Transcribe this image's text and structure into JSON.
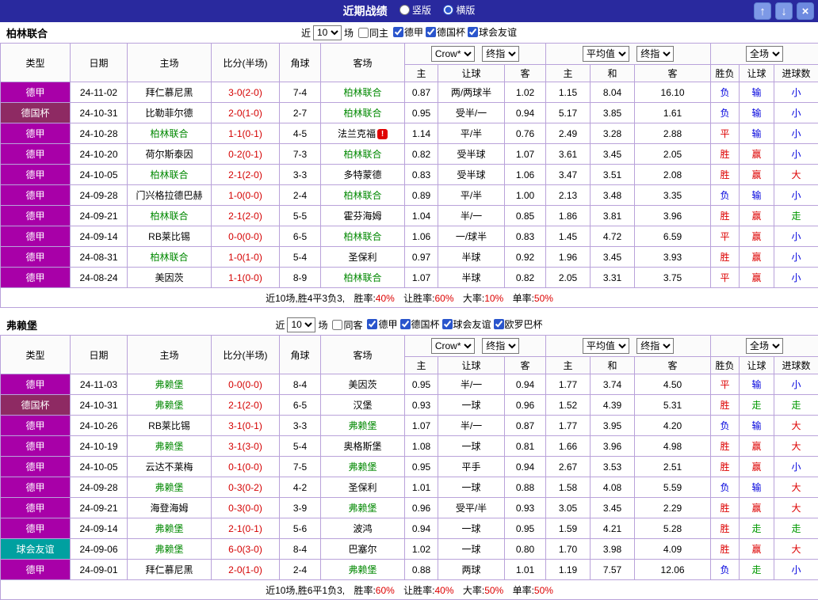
{
  "titlebar": {
    "title": "近期战绩",
    "layout_options": [
      {
        "label": "竖版",
        "selected": false
      },
      {
        "label": "横版",
        "selected": true
      }
    ],
    "buttons": [
      {
        "name": "scroll-up",
        "glyph": "↑"
      },
      {
        "name": "scroll-down",
        "glyph": "↓"
      },
      {
        "name": "close",
        "glyph": "×"
      }
    ]
  },
  "colors": {
    "titlebar_bg": "#29299e",
    "grid_border": "#b9a2da",
    "league": {
      "德甲": "#a800a8",
      "德国杯": "#8e2a63",
      "球会友谊": "#00a0a0"
    },
    "result": {
      "胜": "#dd0000",
      "平": "#dd0000",
      "负": "#0000dd",
      "赢": "#dd0000",
      "输": "#0000dd",
      "走": "#009900",
      "大": "#dd0000",
      "小": "#0000dd"
    },
    "score_text": "#d40000",
    "focus_team": "#008800",
    "summary_value": "#dd0000"
  },
  "columns": {
    "fixed": [
      "类型",
      "日期",
      "主场",
      "比分(半场)",
      "角球",
      "客场"
    ],
    "sub": [
      "主",
      "让球",
      "客",
      "主",
      "和",
      "客",
      "胜负",
      "让球",
      "进球数"
    ]
  },
  "sections": [
    {
      "team": "柏林联合",
      "filters": {
        "near": "近",
        "count": "10",
        "unit": "场",
        "same": "同主",
        "same_checked": false,
        "leagues": [
          "德甲",
          "德国杯",
          "球会友谊"
        ]
      },
      "dropdowns": {
        "asian_source": "Crow*",
        "asian_kind": "终指",
        "euro_source": "平均值",
        "euro_kind": "终指",
        "scope": "全场"
      },
      "rows": [
        {
          "league": "德甲",
          "date": "24-11-02",
          "home": "拜仁慕尼黑",
          "score": "3-0(2-0)",
          "corner": "7-4",
          "away": "柏林联合",
          "away_focus": true,
          "asian_home": "0.87",
          "handicap": "两/两球半",
          "asian_away": "1.02",
          "euro_home": "1.15",
          "euro_draw": "8.04",
          "euro_away": "16.10",
          "outcome": "负",
          "handicap_outcome": "输",
          "goals_outcome": "小"
        },
        {
          "league": "德国杯",
          "date": "24-10-31",
          "home": "比勒菲尔德",
          "score": "2-0(1-0)",
          "corner": "2-7",
          "away": "柏林联合",
          "away_focus": true,
          "asian_home": "0.95",
          "handicap": "受半/一",
          "asian_away": "0.94",
          "euro_home": "5.17",
          "euro_draw": "3.85",
          "euro_away": "1.61",
          "outcome": "负",
          "handicap_outcome": "输",
          "goals_outcome": "小"
        },
        {
          "league": "德甲",
          "date": "24-10-28",
          "home": "柏林联合",
          "home_focus": true,
          "score": "1-1(0-1)",
          "corner": "4-5",
          "away": "法兰克福",
          "away_alert": true,
          "asian_home": "1.14",
          "handicap": "平/半",
          "asian_away": "0.76",
          "euro_home": "2.49",
          "euro_draw": "3.28",
          "euro_away": "2.88",
          "outcome": "平",
          "handicap_outcome": "输",
          "goals_outcome": "小"
        },
        {
          "league": "德甲",
          "date": "24-10-20",
          "home": "荷尔斯泰因",
          "score": "0-2(0-1)",
          "corner": "7-3",
          "away": "柏林联合",
          "away_focus": true,
          "asian_home": "0.82",
          "handicap": "受半球",
          "asian_away": "1.07",
          "euro_home": "3.61",
          "euro_draw": "3.45",
          "euro_away": "2.05",
          "outcome": "胜",
          "handicap_outcome": "赢",
          "goals_outcome": "小"
        },
        {
          "league": "德甲",
          "date": "24-10-05",
          "home": "柏林联合",
          "home_focus": true,
          "score": "2-1(2-0)",
          "corner": "3-3",
          "away": "多特蒙德",
          "asian_home": "0.83",
          "handicap": "受半球",
          "asian_away": "1.06",
          "euro_home": "3.47",
          "euro_draw": "3.51",
          "euro_away": "2.08",
          "outcome": "胜",
          "handicap_outcome": "赢",
          "goals_outcome": "大"
        },
        {
          "league": "德甲",
          "date": "24-09-28",
          "home": "门兴格拉德巴赫",
          "score": "1-0(0-0)",
          "corner": "2-4",
          "away": "柏林联合",
          "away_focus": true,
          "asian_home": "0.89",
          "handicap": "平/半",
          "asian_away": "1.00",
          "euro_home": "2.13",
          "euro_draw": "3.48",
          "euro_away": "3.35",
          "outcome": "负",
          "handicap_outcome": "输",
          "goals_outcome": "小"
        },
        {
          "league": "德甲",
          "date": "24-09-21",
          "home": "柏林联合",
          "home_focus": true,
          "score": "2-1(2-0)",
          "corner": "5-5",
          "away": "霍芬海姆",
          "asian_home": "1.04",
          "handicap": "半/一",
          "asian_away": "0.85",
          "euro_home": "1.86",
          "euro_draw": "3.81",
          "euro_away": "3.96",
          "outcome": "胜",
          "handicap_outcome": "赢",
          "goals_outcome": "走"
        },
        {
          "league": "德甲",
          "date": "24-09-14",
          "home": "RB莱比锡",
          "score": "0-0(0-0)",
          "corner": "6-5",
          "away": "柏林联合",
          "away_focus": true,
          "asian_home": "1.06",
          "handicap": "一/球半",
          "asian_away": "0.83",
          "euro_home": "1.45",
          "euro_draw": "4.72",
          "euro_away": "6.59",
          "outcome": "平",
          "handicap_outcome": "赢",
          "goals_outcome": "小"
        },
        {
          "league": "德甲",
          "date": "24-08-31",
          "home": "柏林联合",
          "home_focus": true,
          "score": "1-0(1-0)",
          "corner": "5-4",
          "away": "圣保利",
          "asian_home": "0.97",
          "handicap": "半球",
          "asian_away": "0.92",
          "euro_home": "1.96",
          "euro_draw": "3.45",
          "euro_away": "3.93",
          "outcome": "胜",
          "handicap_outcome": "赢",
          "goals_outcome": "小"
        },
        {
          "league": "德甲",
          "date": "24-08-24",
          "home": "美因茨",
          "score": "1-1(0-0)",
          "corner": "8-9",
          "away": "柏林联合",
          "away_focus": true,
          "asian_home": "1.07",
          "handicap": "半球",
          "asian_away": "0.82",
          "euro_home": "2.05",
          "euro_draw": "3.31",
          "euro_away": "3.75",
          "outcome": "平",
          "handicap_outcome": "赢",
          "goals_outcome": "小"
        }
      ],
      "summary": {
        "prefix": "近10场,胜4平3负3,",
        "stats": [
          {
            "label": "胜率:",
            "value": "40%"
          },
          {
            "label": "让胜率:",
            "value": "60%"
          },
          {
            "label": "大率:",
            "value": "10%"
          },
          {
            "label": "单率:",
            "value": "50%"
          }
        ]
      }
    },
    {
      "team": "弗赖堡",
      "filters": {
        "near": "近",
        "count": "10",
        "unit": "场",
        "same": "同客",
        "same_checked": false,
        "leagues": [
          "德甲",
          "德国杯",
          "球会友谊",
          "欧罗巴杯"
        ]
      },
      "dropdowns": {
        "asian_source": "Crow*",
        "asian_kind": "终指",
        "euro_source": "平均值",
        "euro_kind": "终指",
        "scope": "全场"
      },
      "rows": [
        {
          "league": "德甲",
          "date": "24-11-03",
          "home": "弗赖堡",
          "home_focus": true,
          "score": "0-0(0-0)",
          "corner": "8-4",
          "away": "美因茨",
          "asian_home": "0.95",
          "handicap": "半/一",
          "asian_away": "0.94",
          "euro_home": "1.77",
          "euro_draw": "3.74",
          "euro_away": "4.50",
          "outcome": "平",
          "handicap_outcome": "输",
          "goals_outcome": "小"
        },
        {
          "league": "德国杯",
          "date": "24-10-31",
          "home": "弗赖堡",
          "home_focus": true,
          "score": "2-1(2-0)",
          "corner": "6-5",
          "away": "汉堡",
          "asian_home": "0.93",
          "handicap": "一球",
          "asian_away": "0.96",
          "euro_home": "1.52",
          "euro_draw": "4.39",
          "euro_away": "5.31",
          "outcome": "胜",
          "handicap_outcome": "走",
          "goals_outcome": "走"
        },
        {
          "league": "德甲",
          "date": "24-10-26",
          "home": "RB莱比锡",
          "score": "3-1(0-1)",
          "corner": "3-3",
          "away": "弗赖堡",
          "away_focus": true,
          "asian_home": "1.07",
          "handicap": "半/一",
          "asian_away": "0.87",
          "euro_home": "1.77",
          "euro_draw": "3.95",
          "euro_away": "4.20",
          "outcome": "负",
          "handicap_outcome": "输",
          "goals_outcome": "大"
        },
        {
          "league": "德甲",
          "date": "24-10-19",
          "home": "弗赖堡",
          "home_focus": true,
          "score": "3-1(3-0)",
          "corner": "5-4",
          "away": "奥格斯堡",
          "asian_home": "1.08",
          "handicap": "一球",
          "asian_away": "0.81",
          "euro_home": "1.66",
          "euro_draw": "3.96",
          "euro_away": "4.98",
          "outcome": "胜",
          "handicap_outcome": "赢",
          "goals_outcome": "大"
        },
        {
          "league": "德甲",
          "date": "24-10-05",
          "home": "云达不莱梅",
          "score": "0-1(0-0)",
          "corner": "7-5",
          "away": "弗赖堡",
          "away_focus": true,
          "asian_home": "0.95",
          "handicap": "平手",
          "asian_away": "0.94",
          "euro_home": "2.67",
          "euro_draw": "3.53",
          "euro_away": "2.51",
          "outcome": "胜",
          "handicap_outcome": "赢",
          "goals_outcome": "小"
        },
        {
          "league": "德甲",
          "date": "24-09-28",
          "home": "弗赖堡",
          "home_focus": true,
          "score": "0-3(0-2)",
          "corner": "4-2",
          "away": "圣保利",
          "asian_home": "1.01",
          "handicap": "一球",
          "asian_away": "0.88",
          "euro_home": "1.58",
          "euro_draw": "4.08",
          "euro_away": "5.59",
          "outcome": "负",
          "handicap_outcome": "输",
          "goals_outcome": "大"
        },
        {
          "league": "德甲",
          "date": "24-09-21",
          "home": "海登海姆",
          "score": "0-3(0-0)",
          "corner": "3-9",
          "away": "弗赖堡",
          "away_focus": true,
          "asian_home": "0.96",
          "handicap": "受平/半",
          "asian_away": "0.93",
          "euro_home": "3.05",
          "euro_draw": "3.45",
          "euro_away": "2.29",
          "outcome": "胜",
          "handicap_outcome": "赢",
          "goals_outcome": "大"
        },
        {
          "league": "德甲",
          "date": "24-09-14",
          "home": "弗赖堡",
          "home_focus": true,
          "score": "2-1(0-1)",
          "corner": "5-6",
          "away": "波鸿",
          "asian_home": "0.94",
          "handicap": "一球",
          "asian_away": "0.95",
          "euro_home": "1.59",
          "euro_draw": "4.21",
          "euro_away": "5.28",
          "outcome": "胜",
          "handicap_outcome": "走",
          "goals_outcome": "走"
        },
        {
          "league": "球会友谊",
          "date": "24-09-06",
          "home": "弗赖堡",
          "home_focus": true,
          "score": "6-0(3-0)",
          "corner": "8-4",
          "away": "巴塞尔",
          "asian_home": "1.02",
          "handicap": "一球",
          "asian_away": "0.80",
          "euro_home": "1.70",
          "euro_draw": "3.98",
          "euro_away": "4.09",
          "outcome": "胜",
          "handicap_outcome": "赢",
          "goals_outcome": "大"
        },
        {
          "league": "德甲",
          "date": "24-09-01",
          "home": "拜仁慕尼黑",
          "score": "2-0(1-0)",
          "corner": "2-4",
          "away": "弗赖堡",
          "away_focus": true,
          "asian_home": "0.88",
          "handicap": "两球",
          "asian_away": "1.01",
          "euro_home": "1.19",
          "euro_draw": "7.57",
          "euro_away": "12.06",
          "outcome": "负",
          "handicap_outcome": "走",
          "goals_outcome": "小"
        }
      ],
      "summary": {
        "prefix": "近10场,胜6平1负3,",
        "stats": [
          {
            "label": "胜率:",
            "value": "60%"
          },
          {
            "label": "让胜率:",
            "value": "40%"
          },
          {
            "label": "大率:",
            "value": "50%"
          },
          {
            "label": "单率:",
            "value": "50%"
          }
        ]
      }
    }
  ]
}
